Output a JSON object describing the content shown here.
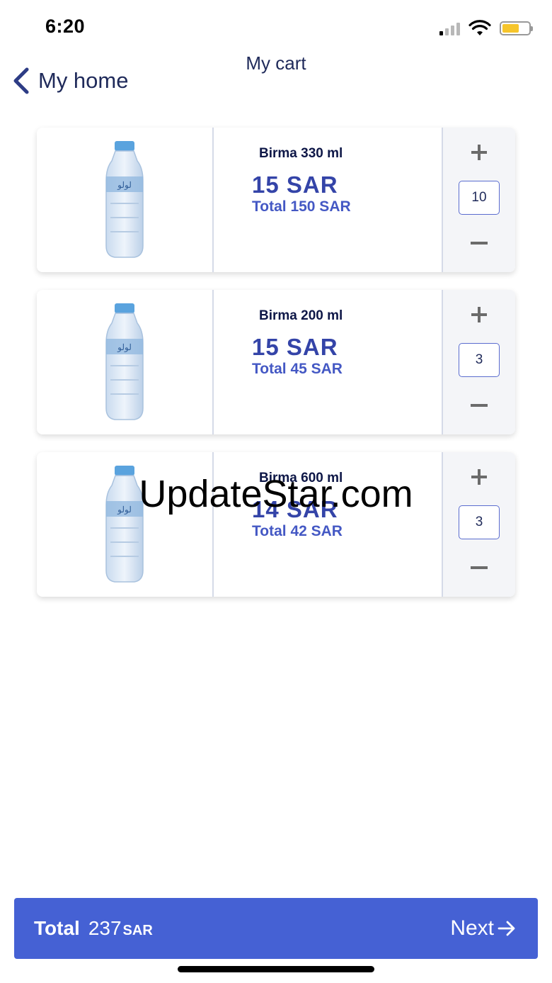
{
  "status_bar": {
    "time": "6:20"
  },
  "header": {
    "title": "My cart",
    "back_label": "My home"
  },
  "cart": {
    "items": [
      {
        "name": "Birma 330 ml",
        "price": "15  SAR",
        "total": "Total 150  SAR",
        "quantity": "10"
      },
      {
        "name": "Birma 200 ml",
        "price": "15  SAR",
        "total": "Total 45  SAR",
        "quantity": "3"
      },
      {
        "name": "Birma 600 ml",
        "price": "14  SAR",
        "total": "Total 42  SAR",
        "quantity": "3"
      }
    ]
  },
  "watermark": "UpdateStar.com",
  "footer": {
    "total_label": "Total",
    "total_value": "237",
    "total_currency": "SAR",
    "next_label": "Next"
  },
  "colors": {
    "accent": "#4561d4",
    "price": "#3444a8",
    "text_dark": "#0e1747"
  }
}
